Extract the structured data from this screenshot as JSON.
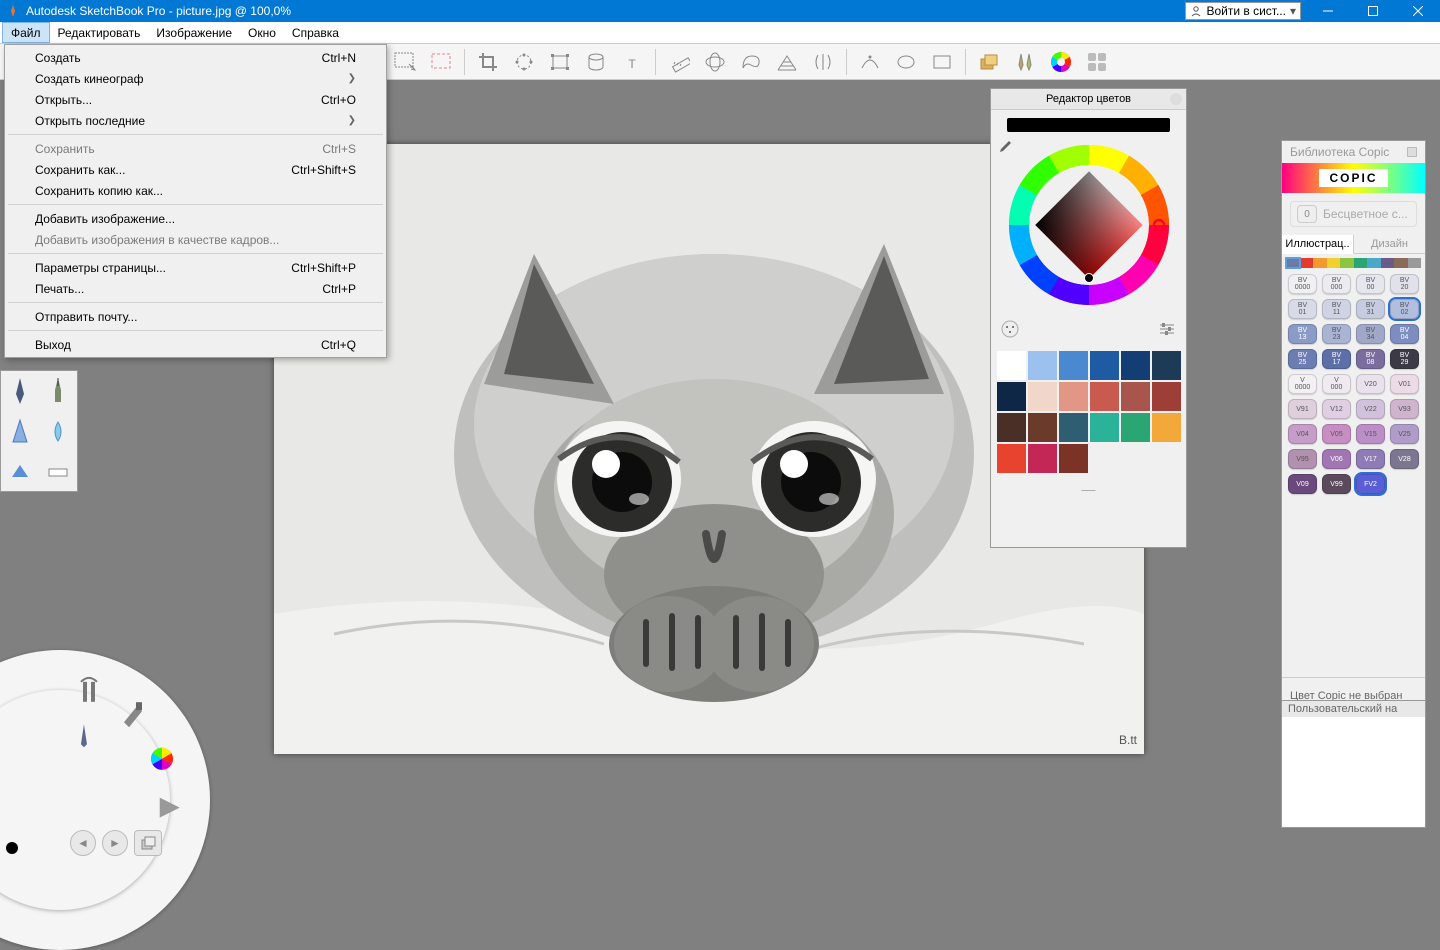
{
  "titlebar": {
    "app_title": "Autodesk SketchBook Pro - picture.jpg @ 100,0%",
    "signin_label": "Войти в сист..."
  },
  "menubar": {
    "items": [
      "Файл",
      "Редактировать",
      "Изображение",
      "Окно",
      "Справка"
    ]
  },
  "file_menu": {
    "items": [
      {
        "label": "Создать",
        "shortcut": "Ctrl+N",
        "disabled": false,
        "submenu": false
      },
      {
        "label": "Создать кинеограф",
        "shortcut": "",
        "disabled": false,
        "submenu": true
      },
      {
        "label": "Открыть...",
        "shortcut": "Ctrl+O",
        "disabled": false,
        "submenu": false
      },
      {
        "label": "Открыть последние",
        "shortcut": "",
        "disabled": false,
        "submenu": true
      },
      {
        "sep": true
      },
      {
        "label": "Сохранить",
        "shortcut": "Ctrl+S",
        "disabled": true,
        "submenu": false
      },
      {
        "label": "Сохранить как...",
        "shortcut": "Ctrl+Shift+S",
        "disabled": false,
        "submenu": false
      },
      {
        "label": "Сохранить копию как...",
        "shortcut": "",
        "disabled": false,
        "submenu": false
      },
      {
        "sep": true
      },
      {
        "label": "Добавить изображение...",
        "shortcut": "",
        "disabled": false,
        "submenu": false
      },
      {
        "label": "Добавить изображения в качестве кадров...",
        "shortcut": "",
        "disabled": true,
        "submenu": false
      },
      {
        "sep": true
      },
      {
        "label": "Параметры страницы...",
        "shortcut": "Ctrl+Shift+P",
        "disabled": false,
        "submenu": false
      },
      {
        "label": "Печать...",
        "shortcut": "Ctrl+P",
        "disabled": false,
        "submenu": false
      },
      {
        "sep": true
      },
      {
        "label": "Отправить почту...",
        "shortcut": "",
        "disabled": false,
        "submenu": false
      },
      {
        "sep": true
      },
      {
        "label": "Выход",
        "shortcut": "Ctrl+Q",
        "disabled": false,
        "submenu": false
      }
    ]
  },
  "toolbar": {
    "icons": [
      "marquee-rect-icon",
      "marquee-dashed-icon",
      "sep",
      "crop-icon",
      "transform-free-icon",
      "transform-box-icon",
      "perspective-icon",
      "text-icon",
      "sep",
      "ruler-icon",
      "ellipse-guide-icon",
      "french-curve-icon",
      "perspective-grid-icon",
      "symmetry-icon",
      "sep",
      "curve-icon",
      "shape-ellipse-icon",
      "shape-rect-icon",
      "sep",
      "layers-icon",
      "brushes-icon",
      "color-wheel-icon",
      "palette-grid-icon"
    ]
  },
  "color_editor": {
    "title": "Редактор цветов",
    "current_color": "#000000",
    "swatches": [
      "#ffffff",
      "#9cc1ee",
      "#4a89cf",
      "#1f5ba3",
      "#123e73",
      "#1d3b57",
      "#0e2747",
      "#f0d7c9",
      "#e29686",
      "#c85a50",
      "#a8564b",
      "#9d3f37",
      "#4a2f27",
      "#6a3b2a",
      "#2f5e73",
      "#2bb39a",
      "#2aa573",
      "#f2a93a",
      "#e8432e",
      "#c22755",
      "#7a3326"
    ]
  },
  "copic": {
    "header": "Библиотека Copic",
    "logo": "COPIC",
    "colorless_badge": "0",
    "colorless_label": "Бесцветное с...",
    "tabs": {
      "active": "Иллюстрац..",
      "inactive": "Дизайн"
    },
    "strip_colors": [
      "#6b7aa6",
      "#e53a2e",
      "#f29a2e",
      "#f2d12e",
      "#8cc63f",
      "#2aa573",
      "#4aa8c9",
      "#6b5a8c",
      "#8a6b5a",
      "#9a9a9a"
    ],
    "chips": [
      {
        "l1": "BV",
        "l2": "0000",
        "bg": "#f0f0f2"
      },
      {
        "l1": "BV",
        "l2": "000",
        "bg": "#ececf0"
      },
      {
        "l1": "BV",
        "l2": "00",
        "bg": "#e6e6ee"
      },
      {
        "l1": "BV",
        "l2": "20",
        "bg": "#e0e1ea"
      },
      {
        "l1": "BV",
        "l2": "01",
        "bg": "#d8dae8"
      },
      {
        "l1": "BV",
        "l2": "11",
        "bg": "#cfd3e4"
      },
      {
        "l1": "BV",
        "l2": "31",
        "bg": "#c6cbdf"
      },
      {
        "l1": "BV",
        "l2": "02",
        "bg": "#b2bedd",
        "sel": true
      },
      {
        "l1": "BV",
        "l2": "13",
        "bg": "#8a9bc7",
        "fg": "#fff"
      },
      {
        "l1": "BV",
        "l2": "23",
        "bg": "#a9b3d2"
      },
      {
        "l1": "BV",
        "l2": "34",
        "bg": "#9fa8c8"
      },
      {
        "l1": "BV",
        "l2": "04",
        "bg": "#7d8dc0",
        "fg": "#fff"
      },
      {
        "l1": "BV",
        "l2": "25",
        "bg": "#6c7db4",
        "fg": "#fff"
      },
      {
        "l1": "BV",
        "l2": "17",
        "bg": "#5d6fa8",
        "fg": "#fff"
      },
      {
        "l1": "BV",
        "l2": "08",
        "bg": "#7a6d9e",
        "fg": "#fff"
      },
      {
        "l1": "BV",
        "l2": "29",
        "bg": "#3c3a46",
        "fg": "#fff"
      },
      {
        "l1": "V",
        "l2": "0000",
        "bg": "#f3f0f3"
      },
      {
        "l1": "V",
        "l2": "000",
        "bg": "#efe9f0"
      },
      {
        "l1": "V20",
        "l2": "",
        "bg": "#e9e1ec"
      },
      {
        "l1": "V01",
        "l2": "",
        "bg": "#eadbe6"
      },
      {
        "l1": "V91",
        "l2": "",
        "bg": "#decfdd"
      },
      {
        "l1": "V12",
        "l2": "",
        "bg": "#e0cee2"
      },
      {
        "l1": "V22",
        "l2": "",
        "bg": "#d2c1dc"
      },
      {
        "l1": "V93",
        "l2": "",
        "bg": "#cfb4cd"
      },
      {
        "l1": "V04",
        "l2": "",
        "bg": "#c69cc9"
      },
      {
        "l1": "V05",
        "l2": "",
        "bg": "#c68ec3"
      },
      {
        "l1": "V15",
        "l2": "",
        "bg": "#b98fc6"
      },
      {
        "l1": "V25",
        "l2": "",
        "bg": "#b09cc9"
      },
      {
        "l1": "V95",
        "l2": "",
        "bg": "#b290b0"
      },
      {
        "l1": "V06",
        "l2": "",
        "bg": "#a177b3",
        "fg": "#fff"
      },
      {
        "l1": "V17",
        "l2": "",
        "bg": "#8f7bb5",
        "fg": "#fff"
      },
      {
        "l1": "V28",
        "l2": "",
        "bg": "#7d7691",
        "fg": "#fff"
      },
      {
        "l1": "V09",
        "l2": "",
        "bg": "#6a4a7d",
        "fg": "#fff"
      },
      {
        "l1": "V99",
        "l2": "",
        "bg": "#5a4a5c",
        "fg": "#fff"
      },
      {
        "l1": "FV2",
        "l2": "",
        "bg": "#5a5ed6",
        "fg": "#fff",
        "sel": true
      }
    ],
    "status": "Цвет Copic не выбран",
    "user_header": "Пользовательский на"
  }
}
